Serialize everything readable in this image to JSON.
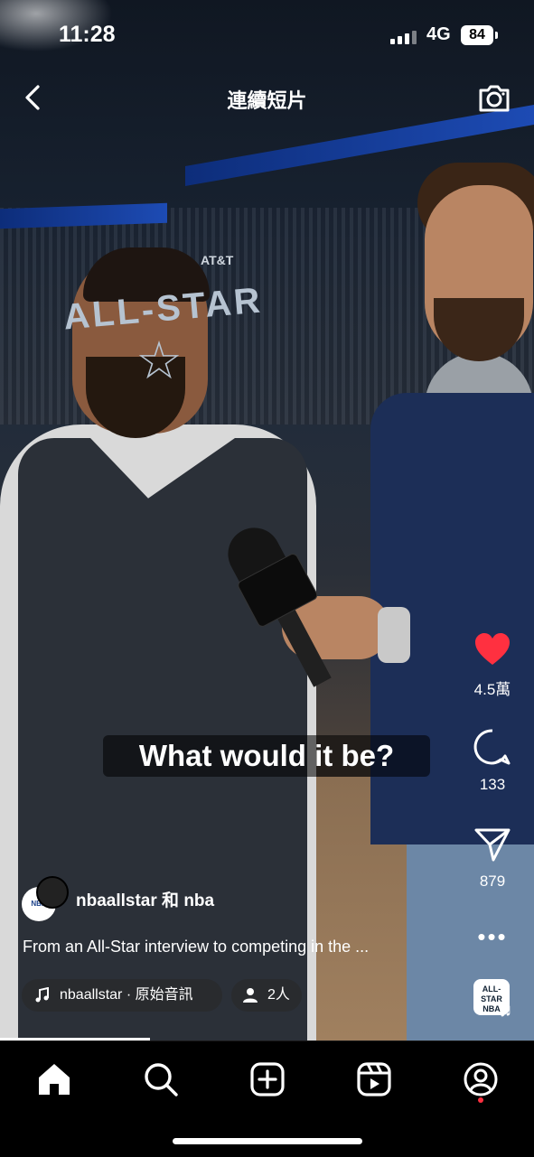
{
  "status_bar": {
    "time": "11:28",
    "network": "4G",
    "battery": "84"
  },
  "header": {
    "title": "連續短片"
  },
  "video": {
    "caption": "What would it be?",
    "jersey_text": "ALL-STAR",
    "jersey_sponsor": "AT&T"
  },
  "actions": {
    "likes": "4.5萬",
    "comments": "133",
    "shares": "879"
  },
  "post": {
    "users": "nbaallstar 和 nba",
    "description": "From an All-Star interview to competing in the ...",
    "audio": "nbaallstar · 原始音訊",
    "people_count": "2人"
  },
  "colors": {
    "like": "#ff3040",
    "nav_bg": "#000000"
  }
}
